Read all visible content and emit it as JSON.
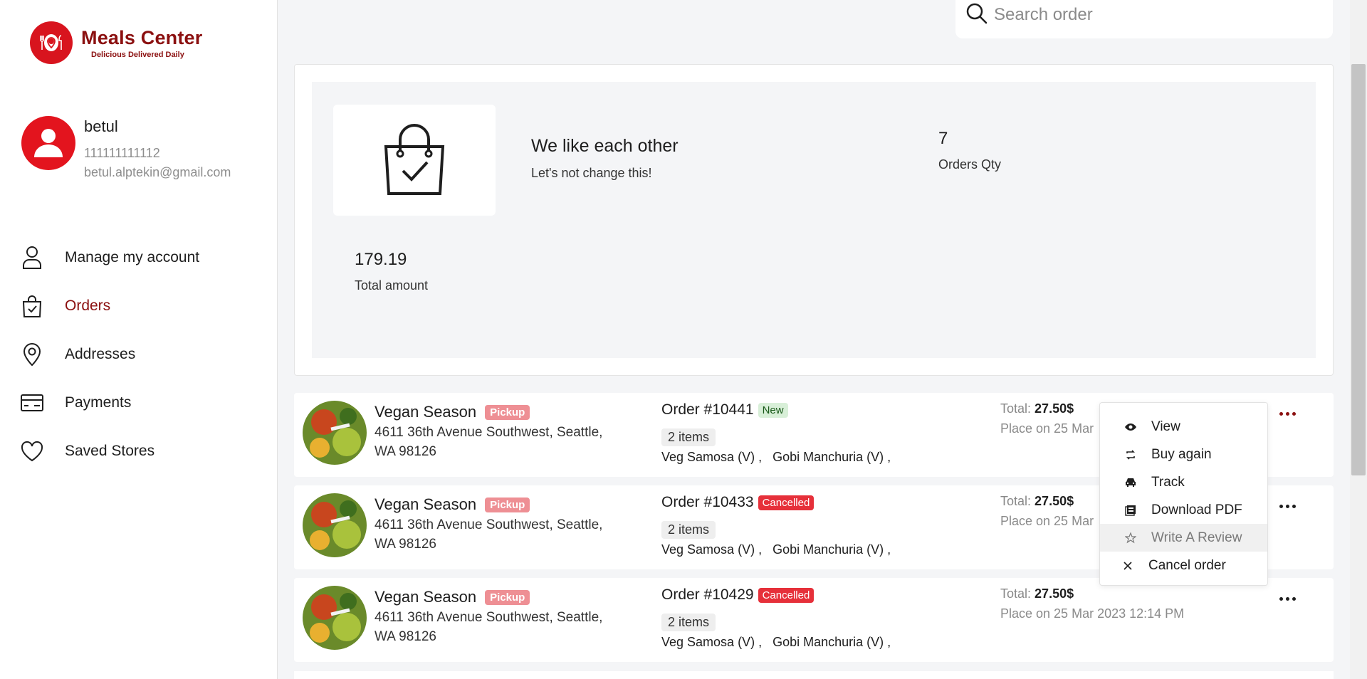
{
  "brand": {
    "title": "Meals Center",
    "tagline": "Delicious Delivered Daily",
    "color": "#8b1010",
    "accent": "#d8141e"
  },
  "profile": {
    "name": "betul",
    "phone": "111111111112",
    "email": "betul.alptekin@gmail.com"
  },
  "nav": [
    {
      "label": "Manage my account",
      "icon": "user-icon"
    },
    {
      "label": "Orders",
      "icon": "shopping-bag-icon",
      "active": true
    },
    {
      "label": "Addresses",
      "icon": "location-pin-icon"
    },
    {
      "label": "Payments",
      "icon": "credit-card-icon"
    },
    {
      "label": "Saved Stores",
      "icon": "heart-icon"
    }
  ],
  "search": {
    "placeholder": "Search order"
  },
  "summary": {
    "title": "We like each other",
    "subtitle": "Let's not change this!",
    "orders_qty_value": "7",
    "orders_qty_label": "Orders Qty",
    "total_amount_value": "179.19",
    "total_amount_label": "Total amount"
  },
  "orders": [
    {
      "store": "Vegan Season",
      "mode": "Pickup",
      "address": "4611 36th Avenue Southwest, Seattle, WA 98126",
      "order_no": "Order #10441",
      "status": "New",
      "items_count": "2 items",
      "items": "Veg Samosa (V) ,   Gobi Manchuria (V) ,",
      "total_label": "Total:",
      "total_value": "27.50$",
      "placed": "Place on 25 Mar"
    },
    {
      "store": "Vegan Season",
      "mode": "Pickup",
      "address": "4611 36th Avenue Southwest, Seattle, WA 98126",
      "order_no": "Order #10433",
      "status": "Cancelled",
      "items_count": "2 items",
      "items": "Veg Samosa (V) ,   Gobi Manchuria (V) ,",
      "total_label": "Total:",
      "total_value": "27.50$",
      "placed": "Place on 25 Mar"
    },
    {
      "store": "Vegan Season",
      "mode": "Pickup",
      "address": "4611 36th Avenue Southwest, Seattle, WA 98126",
      "order_no": "Order #10429",
      "status": "Cancelled",
      "items_count": "2 items",
      "items": "Veg Samosa (V) ,   Gobi Manchuria (V) ,",
      "total_label": "Total:",
      "total_value": "27.50$",
      "placed": "Place on 25 Mar 2023 12:14 PM"
    }
  ],
  "menu": [
    {
      "label": "View",
      "icon": "eye-icon"
    },
    {
      "label": "Buy again",
      "icon": "repeat-icon"
    },
    {
      "label": "Track",
      "icon": "car-icon"
    },
    {
      "label": "Download PDF",
      "icon": "pdf-icon"
    },
    {
      "label": "Write A Review",
      "icon": "star-icon",
      "hover": true
    },
    {
      "label": "Cancel order",
      "icon": "close-icon"
    }
  ]
}
